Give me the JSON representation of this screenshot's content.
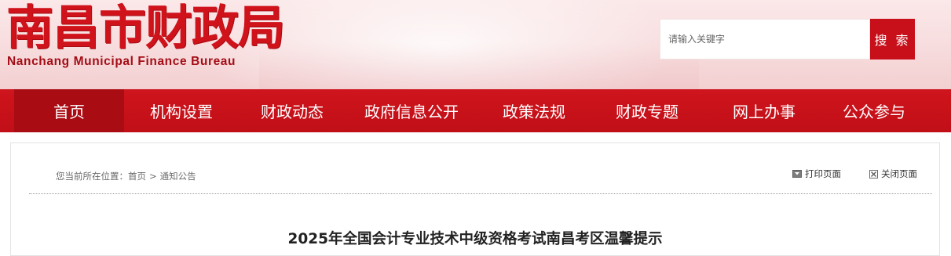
{
  "header": {
    "logo_cn": "南昌市财政局",
    "logo_en": "Nanchang Municipal Finance Bureau"
  },
  "search": {
    "placeholder": "请输入关键字",
    "button_label": "搜 索"
  },
  "nav": {
    "items": [
      {
        "label": "首页",
        "active": true
      },
      {
        "label": "机构设置"
      },
      {
        "label": "财政动态"
      },
      {
        "label": "政府信息公开"
      },
      {
        "label": "政策法规"
      },
      {
        "label": "财政专题"
      },
      {
        "label": "网上办事"
      },
      {
        "label": "公众参与"
      }
    ]
  },
  "breadcrumb": {
    "prefix": "您当前所在位置：",
    "home": "首页",
    "separator": ">",
    "current": "通知公告"
  },
  "tools": {
    "print_label": "打印页面",
    "close_label": "关闭页面"
  },
  "article": {
    "title": "2025年全国会计专业技术中级资格考试南昌考区温馨提示"
  },
  "colors": {
    "brand_red": "#c8101a",
    "nav_active": "#a90c13"
  }
}
